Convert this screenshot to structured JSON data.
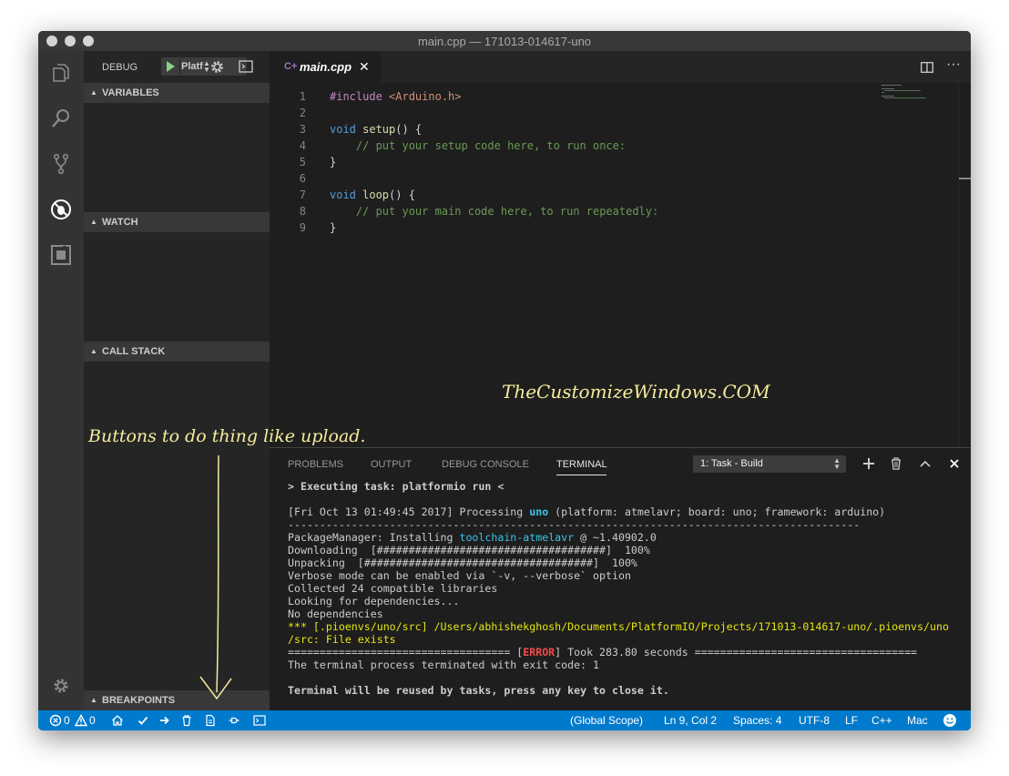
{
  "window": {
    "title": "main.cpp — 171013-014617-uno"
  },
  "activity_bar": {
    "icons": [
      "files-icon",
      "search-icon",
      "source-control-icon",
      "debug-icon",
      "extensions-icon",
      "settings-gear-icon"
    ]
  },
  "debug_bar": {
    "label": "DEBUG",
    "config": "Platf"
  },
  "sidebar": {
    "variables": "VARIABLES",
    "watch": "WATCH",
    "call_stack": "CALL STACK",
    "breakpoints": "BREAKPOINTS"
  },
  "tabs": {
    "active": {
      "label": "main.cpp",
      "icon_text": "C+"
    }
  },
  "editor": {
    "lines": [
      {
        "n": "1",
        "tokens": [
          {
            "t": "#include ",
            "c": "pp"
          },
          {
            "t": "<Arduino.h>",
            "c": "str"
          }
        ]
      },
      {
        "n": "2",
        "tokens": []
      },
      {
        "n": "3",
        "tokens": [
          {
            "t": "void ",
            "c": "kw"
          },
          {
            "t": "setup",
            "c": "fn"
          },
          {
            "t": "() {",
            "c": "pl"
          }
        ]
      },
      {
        "n": "4",
        "tokens": [
          {
            "t": "    // put your setup code here, to run once:",
            "c": "cm"
          }
        ]
      },
      {
        "n": "5",
        "tokens": [
          {
            "t": "}",
            "c": "pl"
          }
        ]
      },
      {
        "n": "6",
        "tokens": []
      },
      {
        "n": "7",
        "tokens": [
          {
            "t": "void ",
            "c": "kw"
          },
          {
            "t": "loop",
            "c": "fn"
          },
          {
            "t": "() {",
            "c": "pl"
          }
        ]
      },
      {
        "n": "8",
        "tokens": [
          {
            "t": "    // put your main code here, to run repeatedly:",
            "c": "cm"
          }
        ]
      },
      {
        "n": "9",
        "tokens": [
          {
            "t": "}",
            "c": "pl"
          }
        ]
      }
    ]
  },
  "watermark": "TheCustomizeWindows.COM",
  "annotation": "Buttons to do thing like upload.",
  "panel": {
    "tabs": [
      "PROBLEMS",
      "OUTPUT",
      "DEBUG CONSOLE",
      "TERMINAL"
    ],
    "active_tab": "TERMINAL",
    "task_select": "1: Task - Build",
    "terminal": [
      {
        "spans": [
          {
            "t": "> Executing task: platformio run <",
            "c": "bold"
          }
        ]
      },
      {
        "spans": []
      },
      {
        "spans": [
          {
            "t": "[Fri Oct 13 01:49:45 2017] Processing ",
            "c": ""
          },
          {
            "t": "uno",
            "c": "cyan bold"
          },
          {
            "t": " (platform: atmelavr; board: uno; framework: arduino)",
            "c": ""
          }
        ]
      },
      {
        "spans": [
          {
            "t": "------------------------------------------------------------------------------------------",
            "c": ""
          }
        ]
      },
      {
        "spans": [
          {
            "t": "PackageManager: Installing ",
            "c": ""
          },
          {
            "t": "toolchain-atmelavr",
            "c": "cyan"
          },
          {
            "t": " @ ~1.40902.0",
            "c": ""
          }
        ]
      },
      {
        "spans": [
          {
            "t": "Downloading  [####################################]  100%",
            "c": ""
          }
        ]
      },
      {
        "spans": [
          {
            "t": "Unpacking  [####################################]  100%",
            "c": ""
          }
        ]
      },
      {
        "spans": [
          {
            "t": "Verbose mode can be enabled via `-v, --verbose` option",
            "c": ""
          }
        ]
      },
      {
        "spans": [
          {
            "t": "Collected 24 compatible libraries",
            "c": ""
          }
        ]
      },
      {
        "spans": [
          {
            "t": "Looking for dependencies...",
            "c": ""
          }
        ]
      },
      {
        "spans": [
          {
            "t": "No dependencies",
            "c": ""
          }
        ]
      },
      {
        "spans": [
          {
            "t": "*** [.pioenvs/uno/src] /Users/abhishekghosh/Documents/PlatformIO/Projects/171013-014617-uno/.pioenvs/uno",
            "c": "yellow"
          }
        ]
      },
      {
        "spans": [
          {
            "t": "/src: File exists",
            "c": "yellow"
          }
        ]
      },
      {
        "spans": [
          {
            "t": "=================================== [",
            "c": ""
          },
          {
            "t": "ERROR",
            "c": "err"
          },
          {
            "t": "] Took 283.80 seconds ===================================",
            "c": ""
          }
        ]
      },
      {
        "spans": [
          {
            "t": "The terminal process terminated with exit code: 1",
            "c": ""
          }
        ]
      },
      {
        "spans": []
      },
      {
        "spans": [
          {
            "t": "Terminal will be reused by tasks, press any key to close it.",
            "c": "bold"
          }
        ]
      }
    ]
  },
  "statusbar": {
    "errors": "0",
    "warnings": "0",
    "scope": "(Global Scope)",
    "position": "Ln 9, Col 2",
    "spaces": "Spaces: 4",
    "encoding": "UTF-8",
    "eol": "LF",
    "language": "C++",
    "platform": "Mac",
    "color": "#007acc"
  }
}
